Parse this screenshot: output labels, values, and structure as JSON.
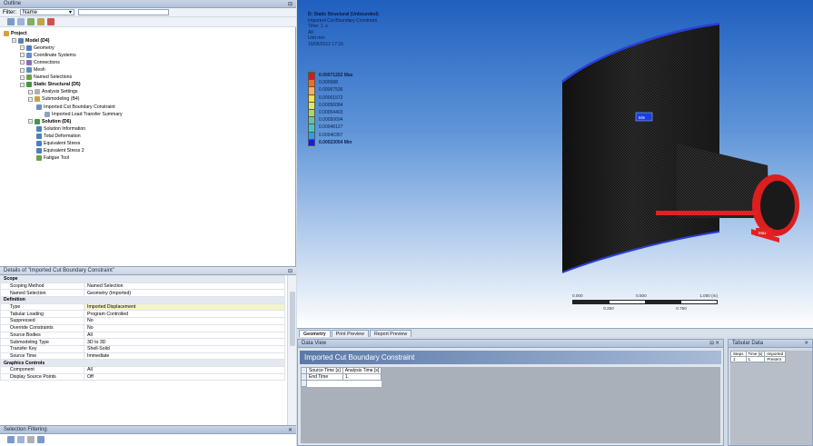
{
  "outline": {
    "title": "Outline",
    "filter_label": "Filter:",
    "filter_value": "Name",
    "tree": [
      {
        "label": "Project",
        "level": 0,
        "bold": true,
        "icon": "project-icon",
        "color": "#d4a43a"
      },
      {
        "label": "Model (D4)",
        "level": 1,
        "bold": true,
        "icon": "model-icon",
        "color": "#5c7fb0"
      },
      {
        "label": "Geometry",
        "level": 2,
        "icon": "geometry-icon",
        "color": "#4a7fc0"
      },
      {
        "label": "Coordinate Systems",
        "level": 2,
        "icon": "coordinate-systems-icon",
        "color": "#6b8fbf"
      },
      {
        "label": "Connections",
        "level": 2,
        "icon": "connections-icon",
        "color": "#8a6fb0"
      },
      {
        "label": "Mesh",
        "level": 2,
        "icon": "mesh-icon",
        "color": "#5a8fbd"
      },
      {
        "label": "Named Selections",
        "level": 2,
        "icon": "named-selections-icon",
        "color": "#6aa048"
      },
      {
        "label": "Static Structural (D5)",
        "level": 2,
        "bold": true,
        "icon": "static-structural-icon",
        "color": "#3f9a3f"
      },
      {
        "label": "Analysis Settings",
        "level": 3,
        "icon": "analysis-settings-icon",
        "color": "#b0b0b0"
      },
      {
        "label": "Submodeling (B4)",
        "level": 3,
        "icon": "submodeling-icon",
        "color": "#c9a040"
      },
      {
        "label": "Imported Cut Boundary Constraint",
        "level": 4,
        "icon": "imported-constraint-icon",
        "color": "#6b8fbf"
      },
      {
        "label": "Imported Load Transfer Summary",
        "level": 5,
        "icon": "load-transfer-icon",
        "color": "#8fa3bf"
      },
      {
        "label": "Solution (D6)",
        "level": 3,
        "bold": true,
        "icon": "solution-icon",
        "color": "#3f9a3f"
      },
      {
        "label": "Solution Information",
        "level": 4,
        "icon": "solution-information-icon",
        "color": "#4a7fc0"
      },
      {
        "label": "Total Deformation",
        "level": 4,
        "icon": "total-deformation-icon",
        "color": "#4a7fc0"
      },
      {
        "label": "Equivalent Stress",
        "level": 4,
        "icon": "equivalent-stress-icon",
        "color": "#4a7fc0"
      },
      {
        "label": "Equivalent Stress 2",
        "level": 4,
        "icon": "equivalent-stress-icon",
        "color": "#4a7fc0"
      },
      {
        "label": "Fatigue Tool",
        "level": 4,
        "icon": "fatigue-tool-icon",
        "color": "#6aa048"
      }
    ]
  },
  "details": {
    "title": "Details of \"Imported Cut Boundary Constraint\"",
    "rows": [
      {
        "group": true,
        "label": "Scope"
      },
      {
        "label": "Scoping Method",
        "value": "Named Selection"
      },
      {
        "label": "Named Selection",
        "value": "Geometry (Imported)"
      },
      {
        "group": true,
        "label": "Definition"
      },
      {
        "label": "Type",
        "value": "Imported Displacement",
        "hl": true
      },
      {
        "label": "Tabular Loading",
        "value": "Program Controlled"
      },
      {
        "label": "Suppressed",
        "value": "No"
      },
      {
        "label": "Override Constraints",
        "value": "No"
      },
      {
        "label": "Source Bodies",
        "value": "All"
      },
      {
        "label": "Submodeling Type",
        "value": "3D to 3D"
      },
      {
        "label": "Transfer Key",
        "value": "Shell-Solid"
      },
      {
        "label": "Source Time",
        "value": "Immediate"
      },
      {
        "group": true,
        "label": "Graphics Controls"
      },
      {
        "label": "Component",
        "value": "All"
      },
      {
        "label": "Display Source Points",
        "value": "Off"
      }
    ]
  },
  "selinfo": {
    "title": "Selection Filtering"
  },
  "viewer": {
    "info": [
      "D: Static Structural (Unbounded)",
      "Imported Cut Boundary Constraint",
      "Time: 1. s",
      "All",
      "Unit mm",
      "10/05/2012 17:16"
    ],
    "legend": [
      {
        "label": "0.00071252 Max",
        "color": "#d7191c",
        "bold": true
      },
      {
        "label": "0.000688",
        "color": "#f46d1e"
      },
      {
        "label": "0.00067536",
        "color": "#fdae61"
      },
      {
        "label": "0.00061572",
        "color": "#fee048"
      },
      {
        "label": "0.00056084",
        "color": "#d9ef5a"
      },
      {
        "label": "0.00054403",
        "color": "#a6d96a"
      },
      {
        "label": "0.00050694",
        "color": "#66c2a5"
      },
      {
        "label": "0.00048127",
        "color": "#3ec9c9"
      },
      {
        "label": "0.00040357",
        "color": "#2b9fe8"
      },
      {
        "label": "0.00023054 Min",
        "color": "#1020e0",
        "bold": true
      }
    ],
    "scale": {
      "t0": "0.000",
      "t1": "0.500",
      "t2": "1.000 (m)",
      "b1": "0.250",
      "b2": "0.750"
    },
    "probe_label": "Min",
    "probe_label2": "Max"
  },
  "tabs": [
    "Geometry",
    "Print Preview",
    "Report Preview"
  ],
  "grid": {
    "title": "Data View",
    "banner": "Imported Cut Boundary Constraint",
    "headers": [
      "Source Time [s]",
      "Analysis Time [s]"
    ],
    "rows": [
      [
        "End Time",
        "1."
      ]
    ]
  },
  "tabular": {
    "title": "Tabular Data",
    "headers": [
      "Steps",
      "Time [s]",
      "Imported"
    ],
    "rows": [
      [
        "1",
        "1.",
        "Present"
      ]
    ]
  }
}
